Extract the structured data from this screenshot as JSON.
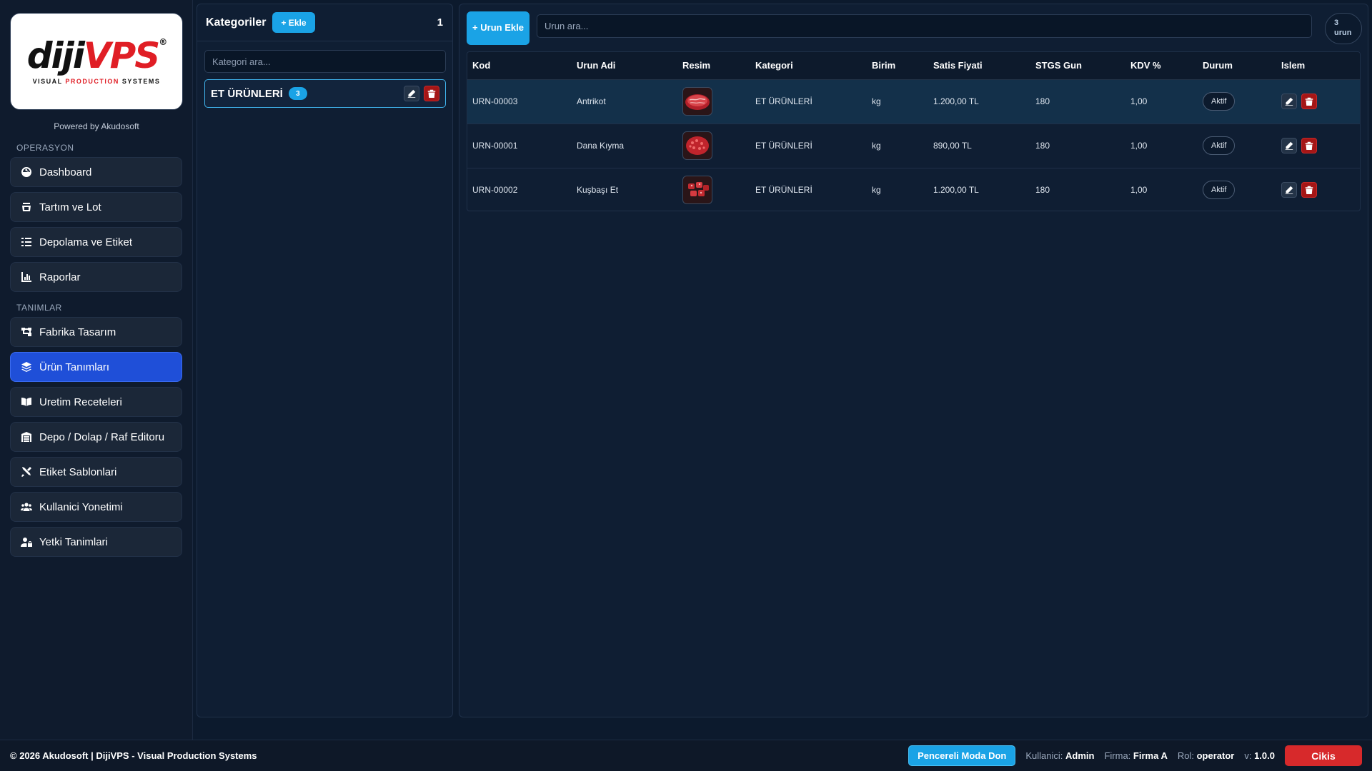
{
  "brand": {
    "logo_word_1": "diji",
    "logo_word_2": "VPS",
    "logo_tag_1": "VISUAL ",
    "logo_tag_2": "PRODUCTION",
    "logo_tag_3": " SYSTEMS",
    "powered_by": "Powered by Akudosoft"
  },
  "sidebar": {
    "section_operasyon": "OPERASYON",
    "section_tanimlar": "TANIMLAR",
    "operasyon_items": [
      {
        "label": "Dashboard",
        "icon": "dashboard-icon"
      },
      {
        "label": "Tartım ve Lot",
        "icon": "scale-icon"
      },
      {
        "label": "Depolama ve Etiket",
        "icon": "list-icon"
      },
      {
        "label": "Raporlar",
        "icon": "chart-icon"
      }
    ],
    "tanimlar_items": [
      {
        "label": "Fabrika Tasarım",
        "icon": "sitemap-icon"
      },
      {
        "label": "Ürün Tanımları",
        "icon": "layers-icon",
        "active": true
      },
      {
        "label": "Uretim Receteleri",
        "icon": "book-icon"
      },
      {
        "label": "Depo / Dolap / Raf Editoru",
        "icon": "warehouse-icon"
      },
      {
        "label": "Etiket Sablonlari",
        "icon": "tools-icon"
      },
      {
        "label": "Kullanici Yonetimi",
        "icon": "users-icon"
      },
      {
        "label": "Yetki Tanimlari",
        "icon": "user-lock-icon"
      }
    ]
  },
  "categories": {
    "title": "Kategoriler",
    "add_label": "+ Ekle",
    "count": "1",
    "search_placeholder": "Kategori ara...",
    "items": [
      {
        "name": "ET ÜRÜNLERİ",
        "count": "3"
      }
    ]
  },
  "products": {
    "add_label": "+ Urun Ekle",
    "search_placeholder": "Urun ara...",
    "count_num": "3",
    "count_unit": "urun",
    "columns": [
      "Kod",
      "Urun Adi",
      "Resim",
      "Kategori",
      "Birim",
      "Satis Fiyati",
      "STGS Gun",
      "KDV %",
      "Durum",
      "Islem"
    ],
    "rows": [
      {
        "kod": "URN-00003",
        "ad": "Antrikot",
        "kategori": "ET ÜRÜNLERİ",
        "birim": "kg",
        "fiyat": "1.200,00 TL",
        "stgs": "180",
        "kdv": "1,00",
        "durum": "Aktif"
      },
      {
        "kod": "URN-00001",
        "ad": "Dana Kıyma",
        "kategori": "ET ÜRÜNLERİ",
        "birim": "kg",
        "fiyat": "890,00 TL",
        "stgs": "180",
        "kdv": "1,00",
        "durum": "Aktif"
      },
      {
        "kod": "URN-00002",
        "ad": "Kuşbaşı Et",
        "kategori": "ET ÜRÜNLERİ",
        "birim": "kg",
        "fiyat": "1.200,00 TL",
        "stgs": "180",
        "kdv": "1,00",
        "durum": "Aktif"
      }
    ]
  },
  "footer": {
    "copyright": "© 2026 Akudosoft | DijiVPS - Visual Production Systems",
    "window_mode_label": "Pencereli Moda Don",
    "user_label": "Kullanici:",
    "user_value": "Admin",
    "firm_label": "Firma:",
    "firm_value": "Firma A",
    "role_label": "Rol:",
    "role_value": "operator",
    "version_label": "v:",
    "version_value": "1.0.0",
    "logout_label": "Cikis"
  },
  "colors": {
    "accent": "#1aa3e6",
    "active_nav": "#1f4fd8",
    "danger": "#d7292b",
    "background": "#0c1a2d"
  }
}
